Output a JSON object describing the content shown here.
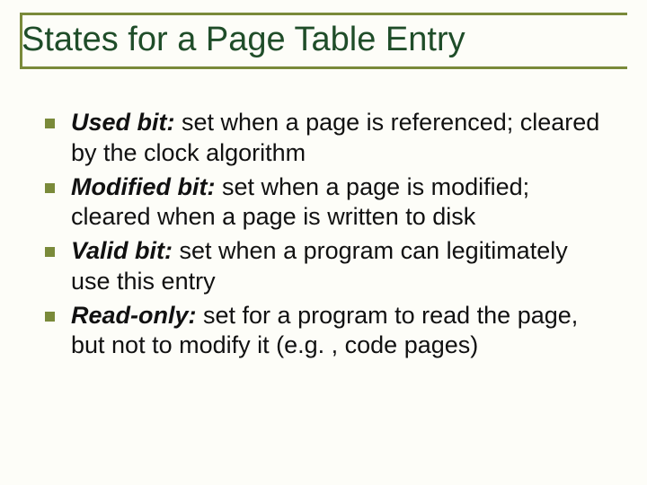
{
  "title": "States for a Page Table Entry",
  "items": [
    {
      "term": "Used bit:",
      "desc": "  set when a page is referenced; cleared by the clock algorithm"
    },
    {
      "term": "Modified bit:",
      "desc": "  set when a page is modified; cleared when a page is written to disk"
    },
    {
      "term": "Valid bit:",
      "desc": "  set when a program can legitimately use this entry"
    },
    {
      "term": "Read-only:",
      "desc": "  set for a program to read the page, but not to modify it (e.g. , code pages)"
    }
  ]
}
